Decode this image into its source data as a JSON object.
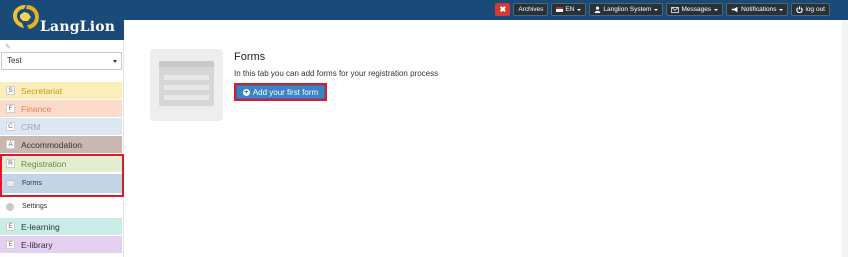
{
  "brand": {
    "name": "LangLion"
  },
  "topbar": {
    "close_glyph": "✖",
    "archives": "Archives",
    "language": "EN",
    "system": "Langlion System",
    "messages": "Messages",
    "notifications": "Notifications",
    "logout": "log out"
  },
  "sidebar": {
    "selector_value": "Test",
    "items": [
      {
        "badge": "S",
        "label": "Secretariat",
        "bg": "#fdedb8",
        "color": "#c89a1f"
      },
      {
        "badge": "F",
        "label": "Finance",
        "bg": "#fbdccc",
        "color": "#e4804c"
      },
      {
        "badge": "C",
        "label": "CRM",
        "bg": "#dde7f2",
        "color": "#9aa7b5"
      },
      {
        "badge": "A",
        "label": "Accommodation",
        "bg": "#c9b8b0",
        "color": "#333333"
      },
      {
        "badge": "R",
        "label": "Registration",
        "bg": "#e3efd0",
        "color": "#6b8b3e"
      }
    ],
    "sub_items": [
      {
        "label": "Forms"
      },
      {
        "label": "Settings"
      }
    ],
    "lower_items": [
      {
        "badge": "E",
        "label": "E-learning",
        "bg": "#c8ece6",
        "color": "#333333"
      },
      {
        "badge": "E",
        "label": "E-library",
        "bg": "#e5d0f2",
        "color": "#333333"
      }
    ]
  },
  "main": {
    "title": "Forms",
    "description": "In this tab you can add forms for your registration process",
    "add_button": "Add your first form"
  }
}
